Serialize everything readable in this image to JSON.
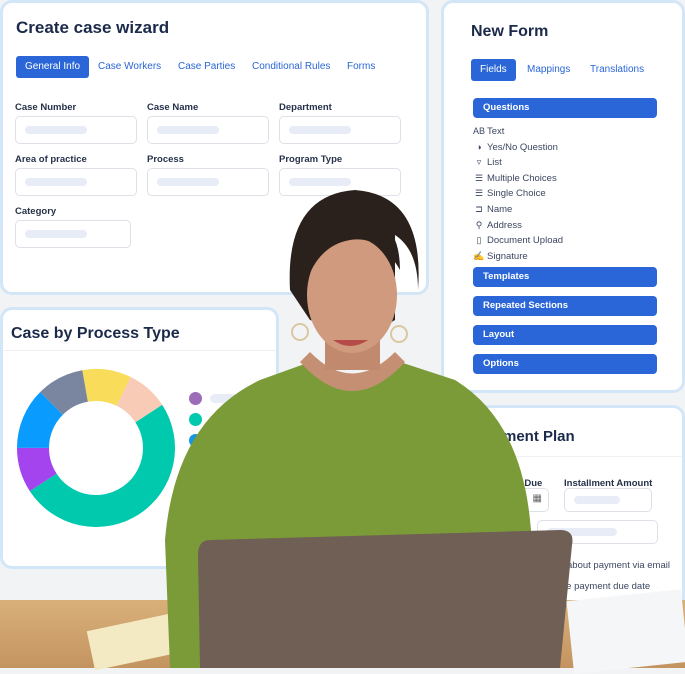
{
  "wizard": {
    "title": "Create case wizard",
    "tabs": [
      {
        "label": "General Info",
        "active": true
      },
      {
        "label": "Case Workers"
      },
      {
        "label": "Case Parties"
      },
      {
        "label": "Conditional Rules"
      },
      {
        "label": "Forms"
      }
    ],
    "fields": [
      "Case Number",
      "Case Name",
      "Department",
      "Area of practice",
      "Process",
      "Program Type",
      "Category"
    ]
  },
  "form": {
    "title": "New Form",
    "tabs": [
      {
        "label": "Fields",
        "active": true
      },
      {
        "label": "Mappings"
      },
      {
        "label": "Translations"
      }
    ],
    "questions_label": "Questions",
    "questions": [
      {
        "icon": "text-ab-icon",
        "glyph": "AB",
        "label": "Text"
      },
      {
        "icon": "yes-no-icon",
        "glyph": "◑",
        "label": "Yes/No Question"
      },
      {
        "icon": "list-icon",
        "glyph": "▿",
        "label": "List"
      },
      {
        "icon": "checklist-icon",
        "glyph": "☰",
        "label": "Multiple Choices"
      },
      {
        "icon": "list-bullets-icon",
        "glyph": "☰",
        "label": "Single Choice"
      },
      {
        "icon": "name-tag-icon",
        "glyph": "⊐",
        "label": "Name"
      },
      {
        "icon": "map-pin-icon",
        "glyph": "⚲",
        "label": "Address"
      },
      {
        "icon": "document-icon",
        "glyph": "▯",
        "label": "Document Upload"
      },
      {
        "icon": "signature-icon",
        "glyph": "✍",
        "label": "Signature"
      }
    ],
    "sections": [
      "Templates",
      "Repeated Sections",
      "Layout",
      "Options"
    ]
  },
  "chart": {
    "title": "Case by Process Type"
  },
  "chart_data": {
    "type": "pie",
    "donut": true,
    "title": "Case by Process Type",
    "segments": [
      {
        "value": 10,
        "color": "#f8dc5a"
      },
      {
        "value": 8.6,
        "color": "#f7cbb5"
      },
      {
        "value": 50,
        "color": "#00c9ad"
      },
      {
        "value": 9.2,
        "color": "#a344ef"
      },
      {
        "value": 12.5,
        "color": "#0a9bff"
      },
      {
        "value": 9.7,
        "color": "#7a859f"
      }
    ],
    "legend_colors": [
      "#9c6cb8",
      "#00c9ad",
      "#1597e5",
      "#56627e",
      "#e58a4e"
    ]
  },
  "payment": {
    "title": "ment Plan",
    "due_label": "ment Due",
    "amount_label": "Installment Amount",
    "notify1": "about payment via email",
    "notify2": "re payment due date"
  }
}
